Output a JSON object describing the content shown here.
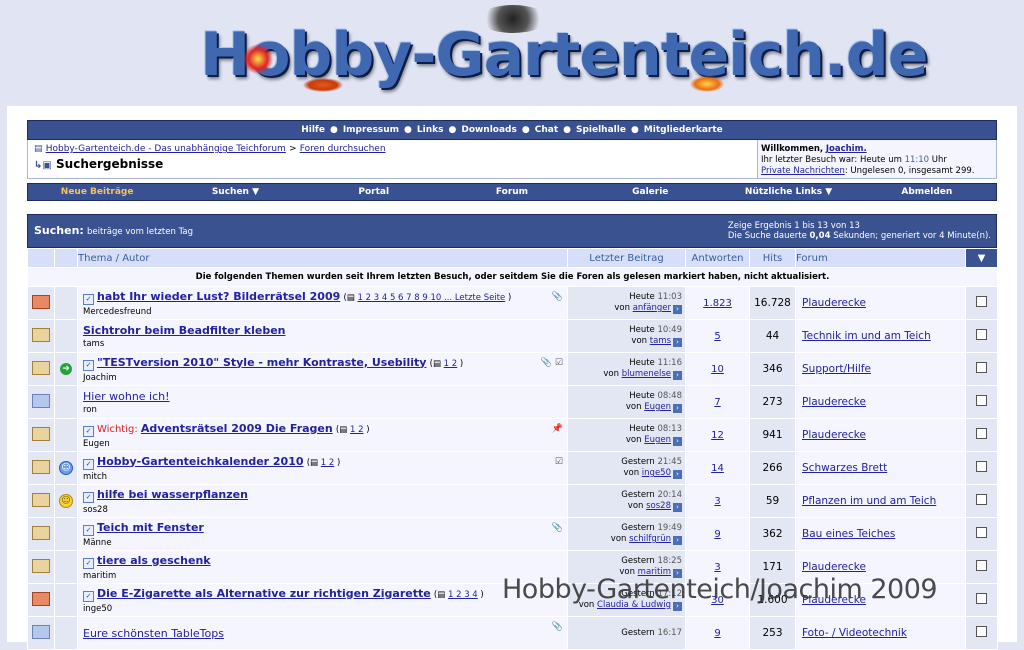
{
  "site": {
    "logo_text": "Hobby-Gartenteich.de"
  },
  "topnav": {
    "items": [
      "Hilfe",
      "Impressum",
      "Links",
      "Downloads",
      "Chat",
      "Spielhalle",
      "Mitgliederkarte"
    ]
  },
  "breadcrumb": {
    "home_link": "Hobby-Gartenteich.de - Das unabhängige Teichforum",
    "separator": ">",
    "section_link": "Foren durchsuchen",
    "title": "Suchergebnisse"
  },
  "welcome": {
    "greeting": "Willkommen,",
    "user": "Joachim.",
    "last_visit_label": "Ihr letzter Besuch war: Heute um",
    "last_visit_time": "11:10",
    "last_visit_suffix": "Uhr",
    "pm_link": "Private Nachrichten",
    "pm_status": ": Ungelesen 0, insgesamt 299."
  },
  "navbar": {
    "items": [
      {
        "label": "Neue Beiträge",
        "active": true
      },
      {
        "label": "Suchen ▼",
        "active": false
      },
      {
        "label": "Portal",
        "active": false
      },
      {
        "label": "Forum",
        "active": false
      },
      {
        "label": "Galerie",
        "active": false
      },
      {
        "label": "Nützliche Links ▼",
        "active": false
      },
      {
        "label": "Abmelden",
        "active": false
      }
    ]
  },
  "search": {
    "title_bold": "Suchen:",
    "title_rest": "beiträge vom letzten Tag",
    "result_info": "Zeige Ergebnis 1 bis 13 von 13",
    "duration_prefix": "Die Suche dauerte",
    "duration_value": "0,04",
    "duration_suffix": "Sekunden; generiert vor 4 Minute(n)."
  },
  "columns": {
    "thema": "Thema / Autor",
    "letzter": "Letzter Beitrag",
    "antworten": "Antworten",
    "hits": "Hits",
    "forum": "Forum",
    "select": "▼"
  },
  "notice": "Die folgenden Themen wurden seit Ihrem letzten Besuch, oder seitdem Sie die Foren als gelesen markiert haben, nicht aktualisiert.",
  "threads": [
    {
      "status": "red",
      "icon": "",
      "prefix": "",
      "title": "habt Ihr wieder Lust? Bilderrätsel 2009",
      "bold": true,
      "check": true,
      "pages": "1 2 3 4 5 6 7 8 9 10 ... Letzte Seite",
      "attach": "📎",
      "starter": "Mercedesfreund",
      "day": "Heute",
      "time": "11:03",
      "by": "anfänger",
      "replies": "1.823",
      "hits": "16.728",
      "forum": "Plauderecke"
    },
    {
      "status": "normal",
      "icon": "",
      "prefix": "",
      "title": "Sichtrohr beim Beadfilter kleben",
      "bold": true,
      "check": false,
      "pages": "",
      "attach": "",
      "starter": "tams",
      "day": "Heute",
      "time": "10:49",
      "by": "tams",
      "replies": "5",
      "hits": "44",
      "forum": "Technik im und am Teich"
    },
    {
      "status": "normal",
      "icon": "green",
      "prefix": "",
      "title": "\"TESTversion 2010\" Style - mehr Kontraste, Usebility",
      "bold": true,
      "check": true,
      "pages": "1 2",
      "attach": "📎 ☑",
      "starter": "Joachim",
      "day": "Heute",
      "time": "11:16",
      "by": "blumenelse",
      "replies": "10",
      "hits": "346",
      "forum": "Support/Hilfe"
    },
    {
      "status": "blue",
      "icon": "",
      "prefix": "",
      "title": "Hier wohne ich!",
      "bold": false,
      "check": false,
      "pages": "",
      "attach": "",
      "starter": "ron",
      "day": "Heute",
      "time": "08:48",
      "by": "Eugen",
      "replies": "7",
      "hits": "273",
      "forum": "Plauderecke"
    },
    {
      "status": "normal",
      "icon": "",
      "prefix": "Wichtig:",
      "title": "Adventsrätsel 2009 Die Fragen",
      "bold": true,
      "check": true,
      "pages": "1 2",
      "attach": "📌",
      "starter": "Eugen",
      "day": "Heute",
      "time": "08:13",
      "by": "Eugen",
      "replies": "12",
      "hits": "941",
      "forum": "Plauderecke"
    },
    {
      "status": "normal",
      "icon": "bluesmile",
      "prefix": "",
      "title": "Hobby-Gartenteichkalender 2010",
      "bold": true,
      "check": true,
      "pages": "1 2",
      "attach": "☑",
      "starter": "mitch",
      "day": "Gestern",
      "time": "21:45",
      "by": "inge50",
      "replies": "14",
      "hits": "266",
      "forum": "Schwarzes Brett"
    },
    {
      "status": "normal",
      "icon": "smile",
      "prefix": "",
      "title": "hilfe bei wasserpflanzen",
      "bold": true,
      "check": true,
      "pages": "",
      "attach": "",
      "starter": "sos28",
      "day": "Gestern",
      "time": "20:14",
      "by": "sos28",
      "replies": "3",
      "hits": "59",
      "forum": "Pflanzen im und am Teich"
    },
    {
      "status": "normal",
      "icon": "",
      "prefix": "",
      "title": "Teich mit Fenster",
      "bold": true,
      "check": true,
      "pages": "",
      "attach": "📎",
      "starter": "Männe",
      "day": "Gestern",
      "time": "19:49",
      "by": "schilfgrün",
      "replies": "9",
      "hits": "362",
      "forum": "Bau eines Teiches"
    },
    {
      "status": "normal",
      "icon": "",
      "prefix": "",
      "title": "tiere als geschenk",
      "bold": true,
      "check": true,
      "pages": "",
      "attach": "",
      "starter": "maritim",
      "day": "Gestern",
      "time": "18:25",
      "by": "maritim",
      "replies": "3",
      "hits": "171",
      "forum": "Plauderecke"
    },
    {
      "status": "red",
      "icon": "",
      "prefix": "",
      "title": "Die E-Zigarette als Alternative zur richtigen Zigarette",
      "bold": true,
      "check": true,
      "pages": "1 2 3 4",
      "attach": "",
      "starter": "inge50",
      "day": "Gestern",
      "time": "17:12",
      "by": "Claudia & Ludwig",
      "replies": "30",
      "hits": "1.600",
      "forum": "Plauderecke"
    },
    {
      "status": "blue",
      "icon": "",
      "prefix": "",
      "title": "Eure schönsten TableTops",
      "bold": false,
      "check": false,
      "pages": "",
      "attach": "📎",
      "starter": "",
      "day": "Gestern",
      "time": "16:17",
      "by": "",
      "replies": "9",
      "hits": "253",
      "forum": "Foto- / Videotechnik"
    }
  ],
  "watermark": "Hobby-Gartenteich/Joachim 2009",
  "colors": {
    "header": "#3a5191",
    "alt_row": "#e3e7f3",
    "row": "#f5f5ff",
    "link": "#22229c",
    "active_nav": "#f7c25c"
  }
}
